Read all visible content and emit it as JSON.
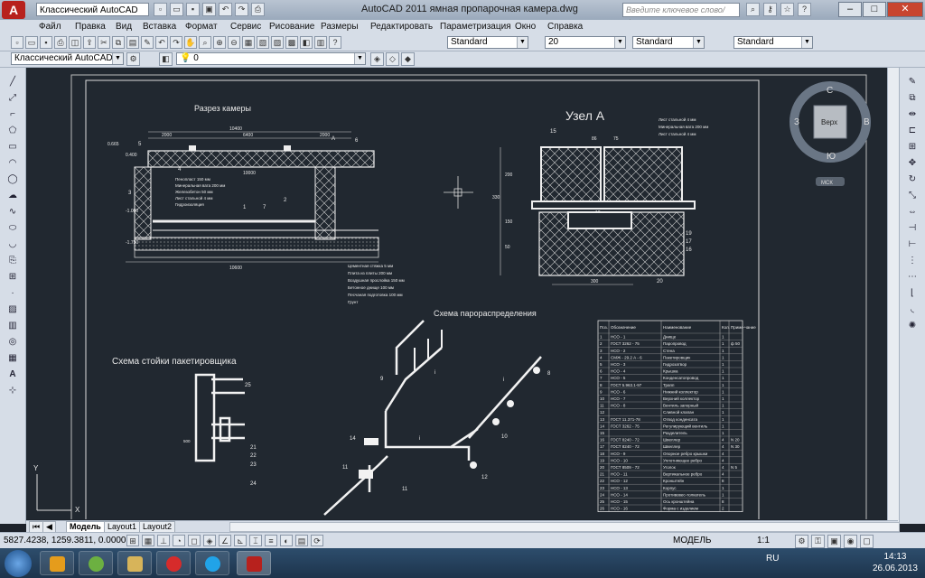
{
  "window": {
    "title": "AutoCAD 2011    ямная пропарочная камера.dwg",
    "workspace": "Классический AutoCAD",
    "search_placeholder": "Введите ключевое слово/фразу",
    "logo": "A"
  },
  "menu": [
    "Файл",
    "Правка",
    "Вид",
    "Вставка",
    "Формат",
    "Сервис",
    "Рисование",
    "Размеры",
    "Редактировать",
    "Параметризация",
    "Окно",
    "Справка"
  ],
  "toolbar": {
    "text_style": "Standard",
    "dim_value": "20",
    "dim_style": "Standard",
    "table_style": "Standard",
    "workspace": "Классический AutoCAD",
    "layer": "0"
  },
  "viewcube": {
    "north": "С",
    "south": "Ю",
    "west": "З",
    "east": "В",
    "face": "Верх",
    "ucs": "МСК"
  },
  "drawing": {
    "section_title": "Разрез камеры",
    "node_title": "Узел A",
    "steam_title": "Схема парораспределения",
    "rack_title": "Схема стойки пакетировщика",
    "top_dim": "10400",
    "sub_dims": [
      "2000",
      "6400",
      "2000"
    ],
    "inner_dim": "10000",
    "bottom_dim": "10600",
    "left_levels": [
      "0.665",
      "0.400",
      "-1.000",
      "-1.750"
    ],
    "callouts": [
      "5",
      "6",
      "A",
      "4",
      "3",
      "1",
      "7",
      "2"
    ],
    "layers_left": [
      "Пенопласт 150 мм",
      "Минеральная вата 200 мм",
      "Железобетон 50 мм",
      "Лист стальной 4 мм",
      "Гидроизоляция"
    ],
    "floor_layers": [
      "Цементная стяжка 5 мм",
      "Плита из плиты 200 мм",
      "Воздушная прослойка 150 мм",
      "Бетонное днище 100 мм",
      "Песчаная подготовка 100 мм",
      "Грунт"
    ],
    "node_layers": [
      "Лист стальной 4 мм",
      "Минеральная вата 200 мм",
      "Лист стальной 4 мм"
    ],
    "node_dims": [
      "86",
      "75",
      "18",
      "300",
      "200",
      "330",
      "150",
      "50"
    ],
    "node_callouts": [
      "15",
      "19",
      "17",
      "16",
      "20"
    ],
    "steam_callouts": [
      "9",
      "8",
      "10",
      "14",
      "11",
      "12",
      "11",
      "i",
      "i",
      "i"
    ],
    "rack_callouts": [
      "25",
      "21",
      "22",
      "23",
      "24"
    ],
    "rack_dim": "500"
  },
  "spec_table": {
    "headers": [
      "Поз.",
      "Обозначение",
      "Наименование",
      "Кол.",
      "Приме-чание"
    ],
    "rows": [
      [
        "1",
        "НСО - 1",
        "Днище",
        "1",
        ""
      ],
      [
        "2",
        "ГОСТ 3262 - 75",
        "Паропровод",
        "1",
        "ф 50"
      ],
      [
        "3",
        "НСО - 2",
        "Стена",
        "1",
        ""
      ],
      [
        "4",
        "СМЖ - 29.2 А - 6",
        "Пакетировщик",
        "1",
        ""
      ],
      [
        "5",
        "НСО - 3",
        "Гидрозатвор",
        "1",
        ""
      ],
      [
        "6",
        "НСО - 4",
        "Крышка",
        "1",
        ""
      ],
      [
        "7",
        "НСО - 5",
        "Конденсатопровод",
        "1",
        ""
      ],
      [
        "8",
        "ГОСТ 5.963.1-97",
        "Трапп",
        "1",
        ""
      ],
      [
        "9",
        "НСО - 6",
        "Нижний коллектор",
        "1",
        ""
      ],
      [
        "10",
        "НСО - 7",
        "Верхний коллектор",
        "1",
        ""
      ],
      [
        "11",
        "НСО - 8",
        "Вентиль запорный",
        "1",
        ""
      ],
      [
        "12",
        "",
        "Сливной клапан",
        "1",
        ""
      ],
      [
        "13",
        "ГОСТ 11.371-78",
        "Отвод конденсата",
        "1",
        ""
      ],
      [
        "14",
        "ГОСТ 3262 - 75",
        "Регулирующий вентиль",
        "1",
        ""
      ],
      [
        "15",
        "",
        "Разделитель",
        "1",
        ""
      ],
      [
        "16",
        "ГОСТ 8240 - 72",
        "Швеллер",
        "4",
        "N 20"
      ],
      [
        "17",
        "ГОСТ 8240 - 72",
        "Швеллер",
        "4",
        "N 30"
      ],
      [
        "18",
        "НСО - 9",
        "Опорное ребро крышки",
        "4",
        ""
      ],
      [
        "19",
        "НСО - 10",
        "Уплотняющее ребро",
        "4",
        ""
      ],
      [
        "20",
        "ГОСТ 8509 - 72",
        "Уголок",
        "4",
        "N 5"
      ],
      [
        "21",
        "НСО - 11",
        "Вертикальное ребро",
        "4",
        ""
      ],
      [
        "22",
        "НСО - 12",
        "Кронштейн",
        "8",
        ""
      ],
      [
        "23",
        "НСО - 13",
        "Корпус",
        "1",
        ""
      ],
      [
        "24",
        "НСО - 14",
        "Противовес-толкатель",
        "1",
        ""
      ],
      [
        "25",
        "НСО - 15",
        "Ось кронштейна",
        "8",
        ""
      ],
      [
        "26",
        "НСО - 16",
        "Форма с изделием",
        "2",
        ""
      ]
    ]
  },
  "tabs": [
    "Модель",
    "Layout1",
    "Layout2"
  ],
  "status": {
    "coords": "5827.4238, 1259.3811, 0.0000",
    "model": "МОДЕЛЬ",
    "scale": "1:1"
  },
  "taskbar": {
    "lang": "RU",
    "time": "14:13",
    "date": "26.06.2013"
  }
}
